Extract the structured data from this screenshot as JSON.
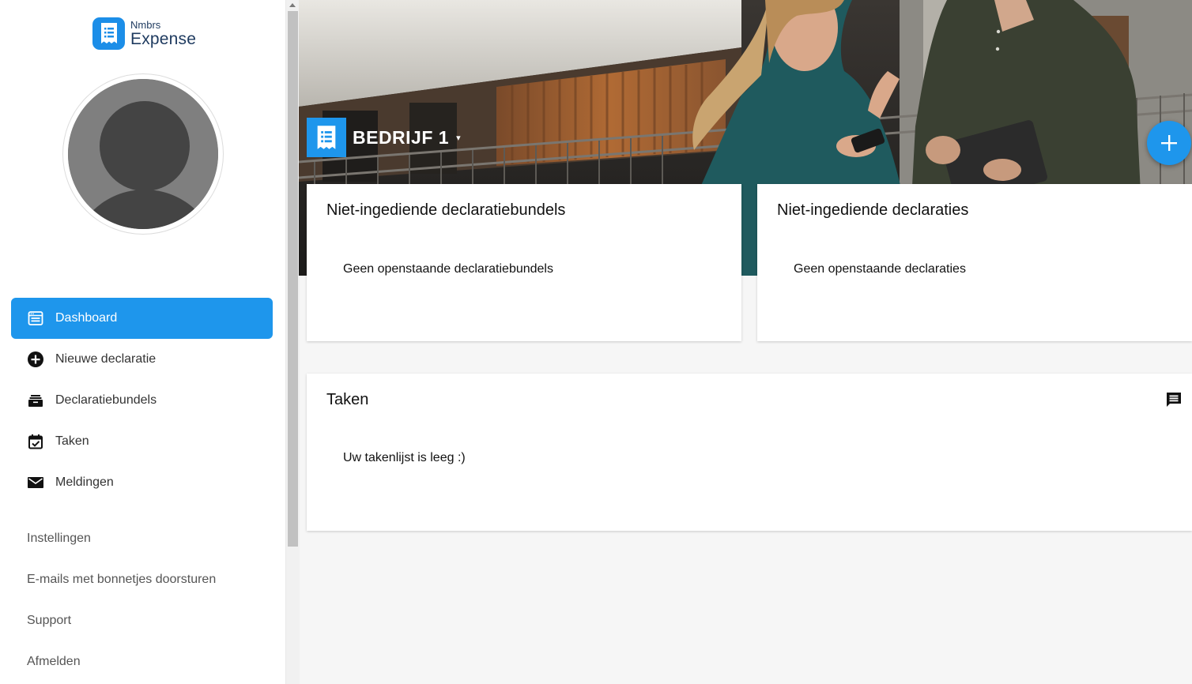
{
  "brand": {
    "small": "Nmbrs",
    "big": "Expense",
    "color": "#1c8ee8"
  },
  "sidebar": {
    "nav": [
      {
        "label": "Dashboard",
        "icon": "dashboard-icon",
        "active": true
      },
      {
        "label": "Nieuwe declaratie",
        "icon": "add-circle-icon"
      },
      {
        "label": "Declaratiebundels",
        "icon": "bundle-icon"
      },
      {
        "label": "Taken",
        "icon": "calendar-check-icon"
      },
      {
        "label": "Meldingen",
        "icon": "mail-icon"
      }
    ],
    "secondary": [
      {
        "label": "Instellingen"
      },
      {
        "label": "E-mails met bonnetjes doorsturen"
      },
      {
        "label": "Support"
      },
      {
        "label": "Afmelden"
      }
    ]
  },
  "header": {
    "company": "BEDRIJF 1",
    "caret": "▾",
    "accent": "#1e96ec"
  },
  "cards": {
    "bundles": {
      "title": "Niet-ingediende declaratiebundels",
      "empty": "Geen openstaande declaratiebundels"
    },
    "declarations": {
      "title": "Niet-ingediende declaraties",
      "empty": "Geen openstaande declaraties"
    },
    "tasks": {
      "title": "Taken",
      "empty": "Uw takenlijst is leeg :)"
    }
  }
}
